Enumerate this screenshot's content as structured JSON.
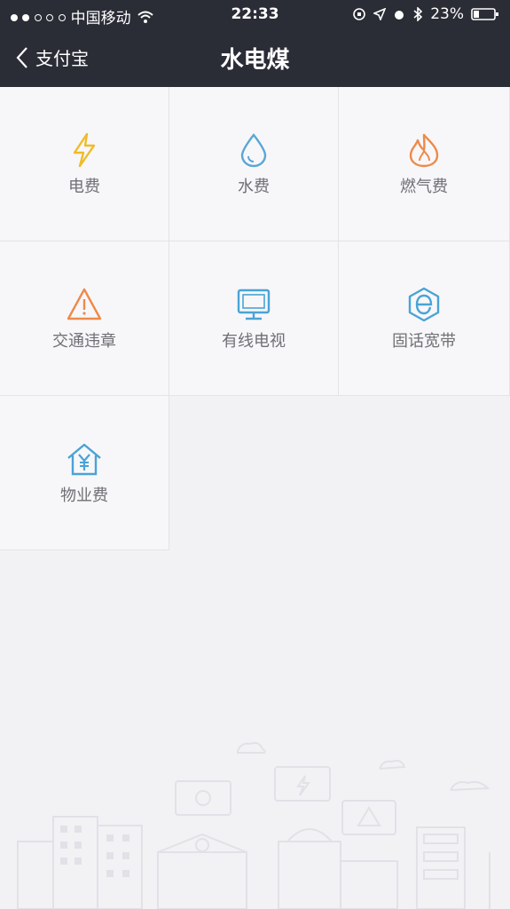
{
  "status_bar": {
    "carrier": "中国移动",
    "time": "22:33",
    "battery": "23%"
  },
  "nav": {
    "back_label": "支付宝",
    "title": "水电煤"
  },
  "services": [
    {
      "label": "电费",
      "icon": "lightning-icon",
      "color": "#f0bb2a"
    },
    {
      "label": "水费",
      "icon": "water-drop-icon",
      "color": "#5aa6d6"
    },
    {
      "label": "燃气费",
      "icon": "flame-icon",
      "color": "#ee8a4a"
    },
    {
      "label": "交通违章",
      "icon": "warning-triangle-icon",
      "color": "#ee8a4a"
    },
    {
      "label": "有线电视",
      "icon": "tv-icon",
      "color": "#4aa3d6"
    },
    {
      "label": "固话宽带",
      "icon": "broadband-e-icon",
      "color": "#4aa3d6"
    },
    {
      "label": "物业费",
      "icon": "house-yen-icon",
      "color": "#4aa3d6"
    }
  ]
}
